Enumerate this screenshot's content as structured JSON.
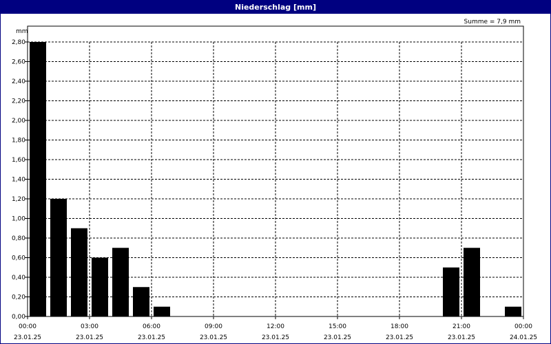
{
  "window": {
    "title": "Niederschlag [mm]"
  },
  "chart_data": {
    "type": "bar",
    "ylabel": "mm",
    "annotation": "Summe = 7,9 mm",
    "ylim": [
      0,
      2.8
    ],
    "y_ticks": [
      "0,00",
      "0,20",
      "0,40",
      "0,60",
      "0,80",
      "1,00",
      "1,20",
      "1,40",
      "1,60",
      "1,80",
      "2,00",
      "2,20",
      "2,40",
      "2,60",
      "2,80"
    ],
    "x_ticks": [
      {
        "time": "00:00",
        "date": "23.01.25"
      },
      {
        "time": "03:00",
        "date": "23.01.25"
      },
      {
        "time": "06:00",
        "date": "23.01.25"
      },
      {
        "time": "09:00",
        "date": "23.01.25"
      },
      {
        "time": "12:00",
        "date": "23.01.25"
      },
      {
        "time": "15:00",
        "date": "23.01.25"
      },
      {
        "time": "18:00",
        "date": "23.01.25"
      },
      {
        "time": "21:00",
        "date": "23.01.25"
      },
      {
        "time": "00:00",
        "date": "24.01.25"
      }
    ],
    "categories": [
      "00:00",
      "01:00",
      "02:00",
      "03:00",
      "04:00",
      "05:00",
      "06:00",
      "07:00",
      "08:00",
      "09:00",
      "10:00",
      "11:00",
      "12:00",
      "13:00",
      "14:00",
      "15:00",
      "16:00",
      "17:00",
      "18:00",
      "19:00",
      "20:00",
      "21:00",
      "22:00",
      "23:00"
    ],
    "values": [
      2.8,
      1.2,
      0.9,
      0.6,
      0.7,
      0.3,
      0.1,
      0,
      0,
      0,
      0,
      0,
      0,
      0,
      0,
      0,
      0,
      0,
      0,
      0,
      0.5,
      0.7,
      0,
      0.1
    ],
    "bar_color": "#000000",
    "grid": true
  }
}
